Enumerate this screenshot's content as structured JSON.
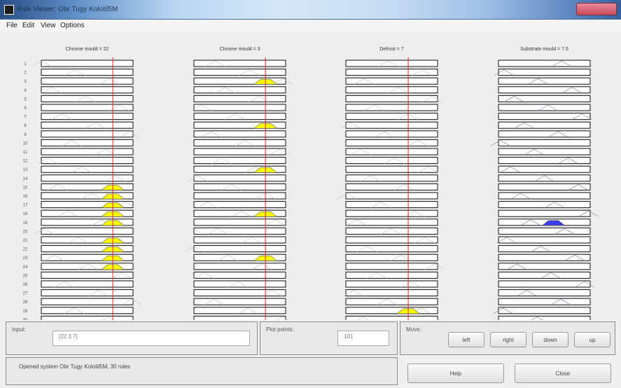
{
  "window": {
    "title": "Rule Viewer: Obr Tugy Kolotil5M"
  },
  "menu": [
    "File",
    "Edit",
    "View",
    "Options"
  ],
  "row_labels": [
    "1",
    "2",
    "3",
    "4",
    "5",
    "6",
    "7",
    "8",
    "9",
    "10",
    "11",
    "12",
    "13",
    "14",
    "15",
    "16",
    "17",
    "18",
    "19",
    "20",
    "21",
    "22",
    "23",
    "24",
    "25",
    "26",
    "27",
    "28",
    "29",
    "30"
  ],
  "columns": [
    {
      "title": "Chrome mould = 22",
      "line_pos": 0.78,
      "markers": [
        15,
        16,
        17,
        18,
        19,
        21,
        22,
        23,
        24
      ]
    },
    {
      "title": "Chrome mould = 3",
      "line_pos": 0.78,
      "markers": [
        3,
        8,
        13,
        18,
        23
      ]
    },
    {
      "title": "Defrost = 7",
      "line_pos": 0.68,
      "markers": [
        29
      ]
    },
    {
      "title": "Substrate mould = 7.5",
      "line_pos": null,
      "markers": [
        19
      ]
    }
  ],
  "colors": {
    "input_fill": "#ffff00",
    "output_fill": "#3c3cf0",
    "indicator_line": "#e02020"
  },
  "input_panel": {
    "label": "Input:",
    "value": "[22 3 7]"
  },
  "plot_points_panel": {
    "label": "Plot points:",
    "value": "101"
  },
  "move_panel": {
    "label": "Move:",
    "buttons": [
      "left",
      "right",
      "down",
      "up"
    ]
  },
  "status": {
    "text": "Opened system Obr Tugy Kolotil5M, 30 rules"
  },
  "actions": {
    "help": "Help",
    "close": "Close"
  }
}
